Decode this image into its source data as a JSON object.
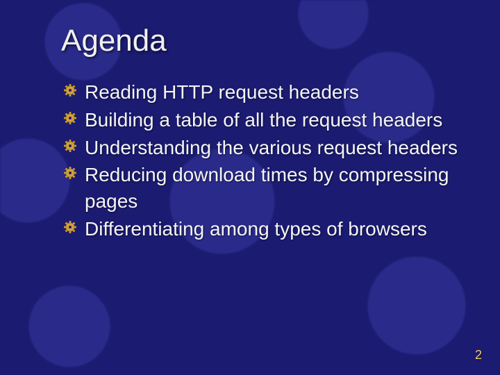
{
  "title": "Agenda",
  "bullets": {
    "b0": "Reading HTTP request headers",
    "b1": "Building a table of all the request headers",
    "b2": "Understanding the various request headers",
    "b3": "Reducing download times by compressing pages",
    "b4": "Differentiating among types of browsers"
  },
  "page_number": "2",
  "colors": {
    "background": "#1b1b72",
    "text": "#f5f5f5",
    "accent": "#f6c96a",
    "bullet_fill": "#d2a23a",
    "bullet_highlight": "#f4d37a"
  }
}
